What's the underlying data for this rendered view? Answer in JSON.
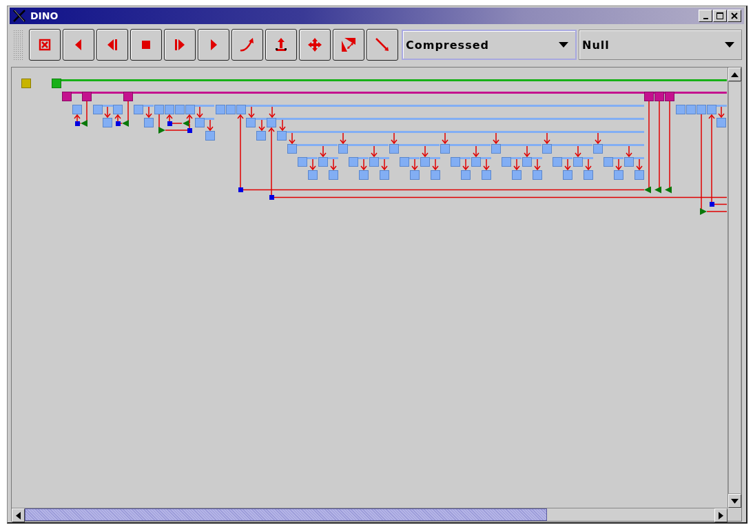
{
  "window": {
    "title": "DINO"
  },
  "toolbar": {
    "dropdowns": [
      {
        "value": "Compressed",
        "focused": true
      },
      {
        "value": "Null",
        "focused": false
      }
    ]
  }
}
